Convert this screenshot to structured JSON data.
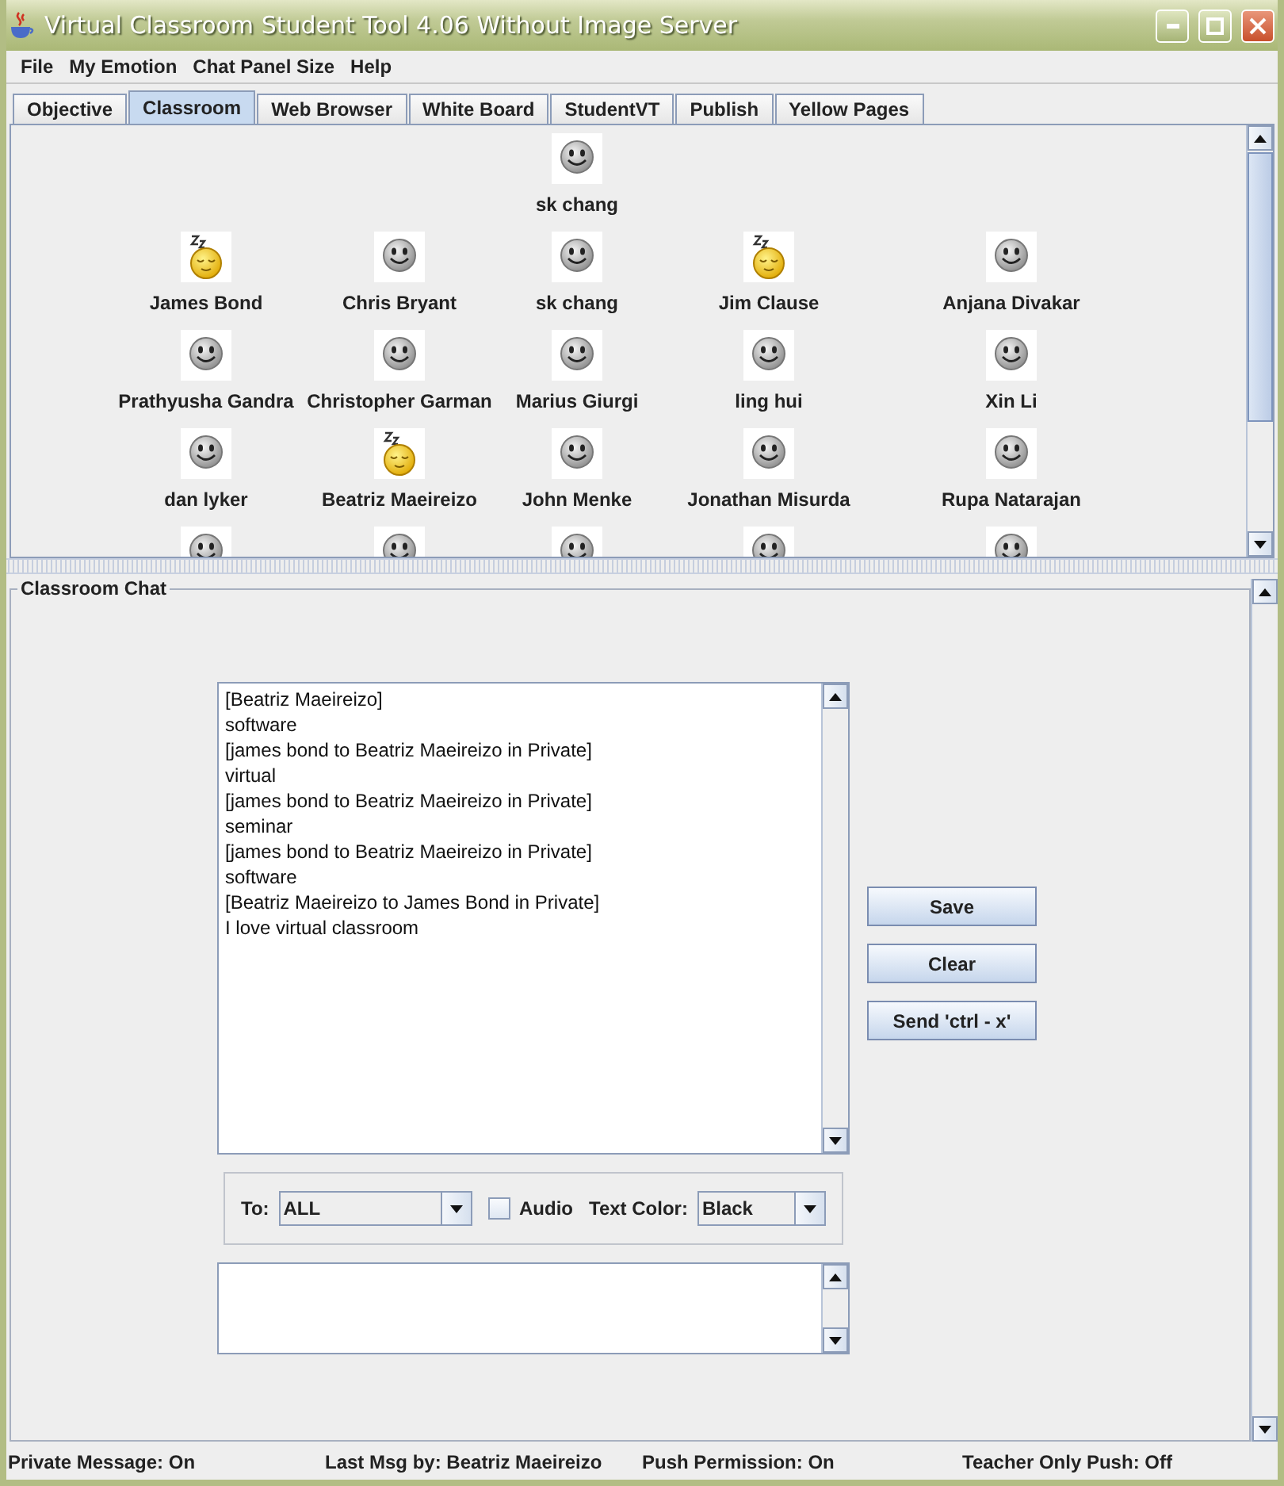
{
  "window": {
    "title": "Virtual Classroom Student Tool 4.06 Without Image Server"
  },
  "menu": [
    "File",
    "My Emotion",
    "Chat Panel Size",
    "Help"
  ],
  "tabs": [
    {
      "label": "Objective",
      "selected": false
    },
    {
      "label": "Classroom",
      "selected": true
    },
    {
      "label": "Web Browser",
      "selected": false
    },
    {
      "label": "White Board",
      "selected": false
    },
    {
      "label": "StudentVT",
      "selected": false
    },
    {
      "label": "Publish",
      "selected": false
    },
    {
      "label": "Yellow Pages",
      "selected": false
    }
  ],
  "classroom": {
    "rows": [
      [
        "",
        "",
        {
          "name": "sk chang",
          "kind": "awake"
        }
      ],
      [
        {
          "name": "James Bond",
          "kind": "asleep"
        },
        {
          "name": "Chris Bryant",
          "kind": "awake"
        },
        {
          "name": "sk chang",
          "kind": "awake"
        },
        {
          "name": "Jim Clause",
          "kind": "asleep"
        },
        {
          "name": "Anjana Divakar",
          "kind": "awake"
        }
      ],
      [
        {
          "name": "Prathyusha Gandra",
          "kind": "awake"
        },
        {
          "name": "Christopher Garman",
          "kind": "awake"
        },
        {
          "name": "Marius Giurgi",
          "kind": "awake"
        },
        {
          "name": "ling hui",
          "kind": "awake"
        },
        {
          "name": "Xin Li",
          "kind": "awake"
        }
      ],
      [
        {
          "name": "dan lyker",
          "kind": "awake"
        },
        {
          "name": "Beatriz Maeireizo",
          "kind": "asleep"
        },
        {
          "name": "John Menke",
          "kind": "awake"
        },
        {
          "name": "Jonathan Misurda",
          "kind": "awake"
        },
        {
          "name": "Rupa Natarajan",
          "kind": "awake"
        }
      ],
      [
        {
          "kind": "awake"
        },
        {
          "kind": "awake"
        },
        {
          "kind": "awake"
        },
        {
          "kind": "awake"
        },
        {
          "kind": "awake"
        }
      ]
    ]
  },
  "chat": {
    "title": "Classroom Chat",
    "messages": [
      "[Beatriz Maeireizo]",
      "software",
      "[james bond to Beatriz Maeireizo in Private]",
      "virtual",
      "[james bond to Beatriz Maeireizo in Private]",
      "seminar",
      "[james bond to Beatriz Maeireizo in Private]",
      "software",
      "[Beatriz Maeireizo to James Bond in Private]",
      "I love virtual classroom"
    ],
    "buttons": [
      "Save",
      "Clear",
      "Send 'ctrl - x'"
    ],
    "to": {
      "label": "To:",
      "value": "ALL"
    },
    "audio": {
      "label": "Audio",
      "checked": false
    },
    "text_color": {
      "label": "Text Color:",
      "value": "Black"
    }
  },
  "status_bar": [
    "Private Message: On",
    "Last Msg by: Beatriz Maeireizo",
    "Push Permission: On",
    "Teacher Only Push: Off"
  ]
}
